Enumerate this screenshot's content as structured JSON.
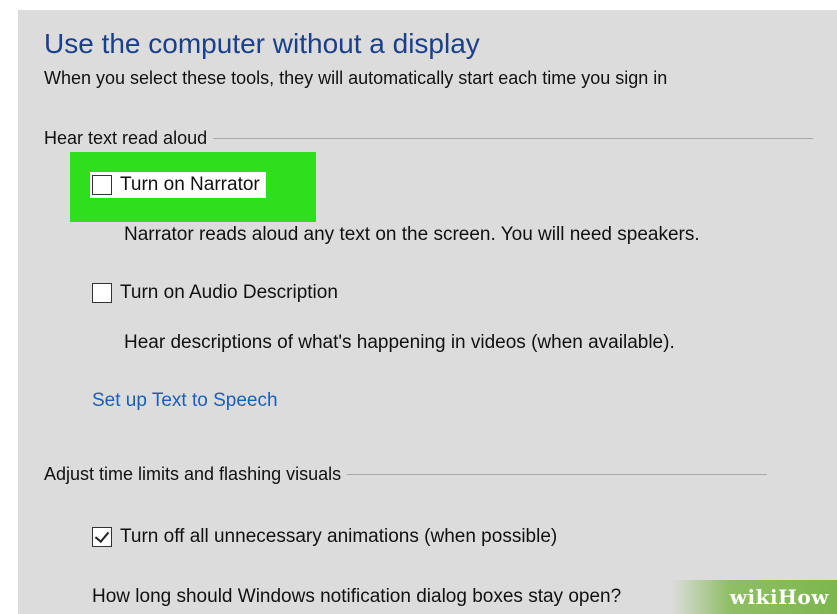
{
  "header": {
    "title": "Use the computer without a display",
    "subtitle": "When you select these tools, they will automatically start each time you sign in"
  },
  "groups": {
    "hear_text": {
      "label": "Hear text read aloud",
      "narrator": {
        "label": "Turn on Narrator",
        "checked": false,
        "description": "Narrator reads aloud any text on the screen. You will need speakers."
      },
      "audio_description": {
        "label": "Turn on Audio Description",
        "checked": false,
        "description": "Hear descriptions of what's happening in videos (when available)."
      },
      "link": "Set up Text to Speech"
    },
    "time_limits": {
      "label": "Adjust time limits and flashing visuals",
      "animations": {
        "label": "Turn off all unnecessary animations (when possible)",
        "checked": true
      },
      "notification_text": "How long should Windows notification dialog boxes stay open?"
    }
  },
  "watermark": {
    "text": "wikiHow"
  },
  "colors": {
    "highlight": "#2ee01c",
    "title": "#1a3f8c",
    "link": "#1a5fb4",
    "background": "#dcdcdc"
  }
}
